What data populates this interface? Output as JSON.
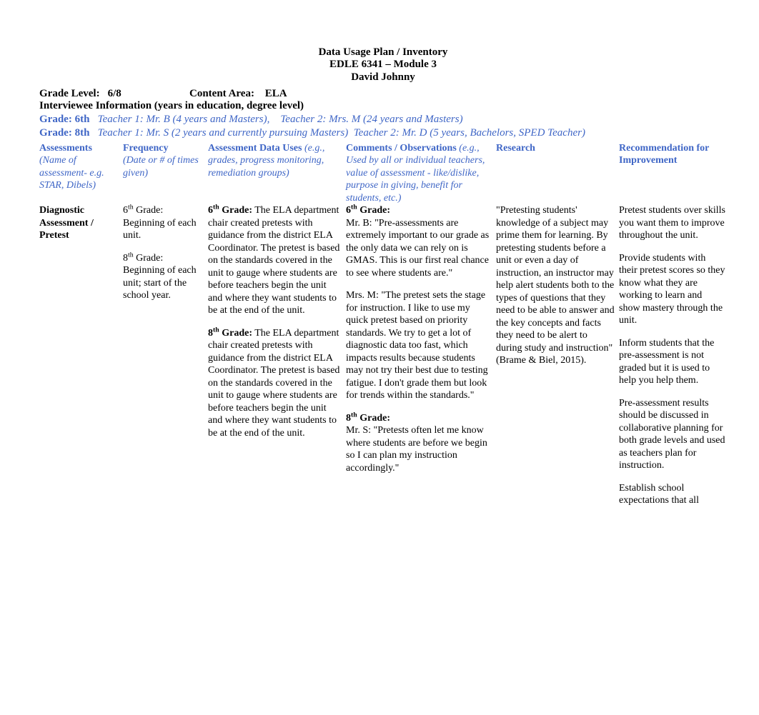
{
  "title": {
    "line1": "Data Usage Plan / Inventory",
    "line2": "EDLE 6341 – Module 3",
    "line3": "David Johnny"
  },
  "meta": {
    "grade_label": "Grade Level:",
    "grade_value": "6/8",
    "content_label": "Content Area:",
    "content_value": "ELA",
    "interviewee_label": "Interviewee Information (years in education, degree level)"
  },
  "grade6": {
    "label": "Grade: 6th",
    "teachers": "   Teacher 1: Mr. B (4 years and Masters),    Teacher 2: Mrs. M (24 years and Masters)"
  },
  "grade8": {
    "label": "Grade: 8th",
    "teachers": "   Teacher 1: Mr. S (2 years and currently pursuing Masters)  Teacher 2: Mr. D (5 years, Bachelors, SPED Teacher)"
  },
  "headers": {
    "c1": "Assessments",
    "c1_sub": "(Name of assessment- e.g. STAR, Dibels)",
    "c2": "Frequency",
    "c2_sub": "(Date or # of times given)",
    "c3": "Assessment Data Uses",
    "c3_sub": " (e.g., grades, progress monitoring, remediation groups)",
    "c4": "Comments / Observations",
    "c4_sub": " (e.g., Used by all or individual teachers, value of assessment - like/dislike, purpose in giving, benefit for students, etc.)",
    "c5": "Research",
    "c6": "Recommendation for Improvement"
  },
  "row1": {
    "name": "Diagnostic Assessment / Pretest",
    "freq_6_pre": "6",
    "freq_6_sup": "th",
    "freq_6": " Grade: Beginning of each unit.",
    "freq_8_pre": "8",
    "freq_8_sup": "th",
    "freq_8": " Grade: Beginning of each unit; start of the school year.",
    "uses_6_pre": "6",
    "uses_6_sup": "th",
    "uses_6_b": " Grade:",
    "uses_6": " The ELA department chair created pretests with guidance from the district ELA Coordinator. The pretest is based on the standards covered in the unit to gauge where students are before teachers begin the unit and where they want students to be at the end of the unit.",
    "uses_8_pre": "8",
    "uses_8_sup": "th",
    "uses_8_b": " Grade:",
    "uses_8": " The ELA department chair created pretests with guidance from the district ELA Coordinator. The pretest is based on the standards covered in the unit to gauge where students are before teachers begin the unit and where they want students to be at the end of the unit.",
    "comm_6_pre": "6",
    "comm_6_sup": "th",
    "comm_6_b": " Grade:",
    "comm_b": "Mr. B: \"Pre-assessments are extremely important to our grade as the only data we can rely on is GMAS. This is our first real chance to see where students are.\"",
    "comm_m": "Mrs. M: \"The pretest sets the stage for instruction. I like to use my quick pretest based on priority standards. We try to get a lot of diagnostic data too fast, which impacts results because students may not try their best due to testing fatigue. I don't grade them but look for trends within the standards.\"",
    "comm_8_pre": "8",
    "comm_8_sup": "th",
    "comm_8_b": " Grade:",
    "comm_s": "Mr. S: \"Pretests often let me know where students are before we begin so I can plan my instruction accordingly.\"",
    "research": "\"Pretesting students' knowledge of a subject may prime them for learning. By pretesting students before a unit or even a day of instruction, an instructor may help alert students both to the types of questions that they need to be able to answer and the key concepts and facts they need to be alert to during study and instruction\" (Brame & Biel, 2015).",
    "rec1": "Pretest students over skills you want them to improve throughout the unit.",
    "rec2": "Provide students with their pretest scores so they know what they are working to learn and show mastery through the unit.",
    "rec3": "Inform students that the pre-assessment is not graded but it is used to help you help them.",
    "rec4": "Pre-assessment results should be discussed in collaborative planning for both grade levels and used as teachers plan for instruction.",
    "rec5": "Establish school expectations that all"
  }
}
